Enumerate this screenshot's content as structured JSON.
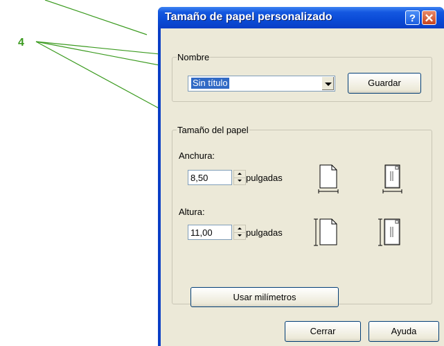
{
  "callout": {
    "number": "4"
  },
  "window": {
    "title": "Tamaño de papel personalizado",
    "help_glyph": "?",
    "close_glyph": "✕"
  },
  "name_group": {
    "legend": "Nombre",
    "combo_value": "Sin título",
    "save_label": "Guardar"
  },
  "size_group": {
    "legend": "Tamaño del papel",
    "width_label": "Anchura:",
    "width_value": "8,50",
    "width_unit": "pulgadas",
    "height_label": "Altura:",
    "height_value": "11,00",
    "height_unit": "pulgadas",
    "mm_button": "Usar milímetros"
  },
  "footer": {
    "close_label": "Cerrar",
    "help_label": "Ayuda"
  },
  "colors": {
    "callout": "#3a9a1e",
    "titlebar": "#0a4bd6",
    "client": "#ece9d8"
  }
}
